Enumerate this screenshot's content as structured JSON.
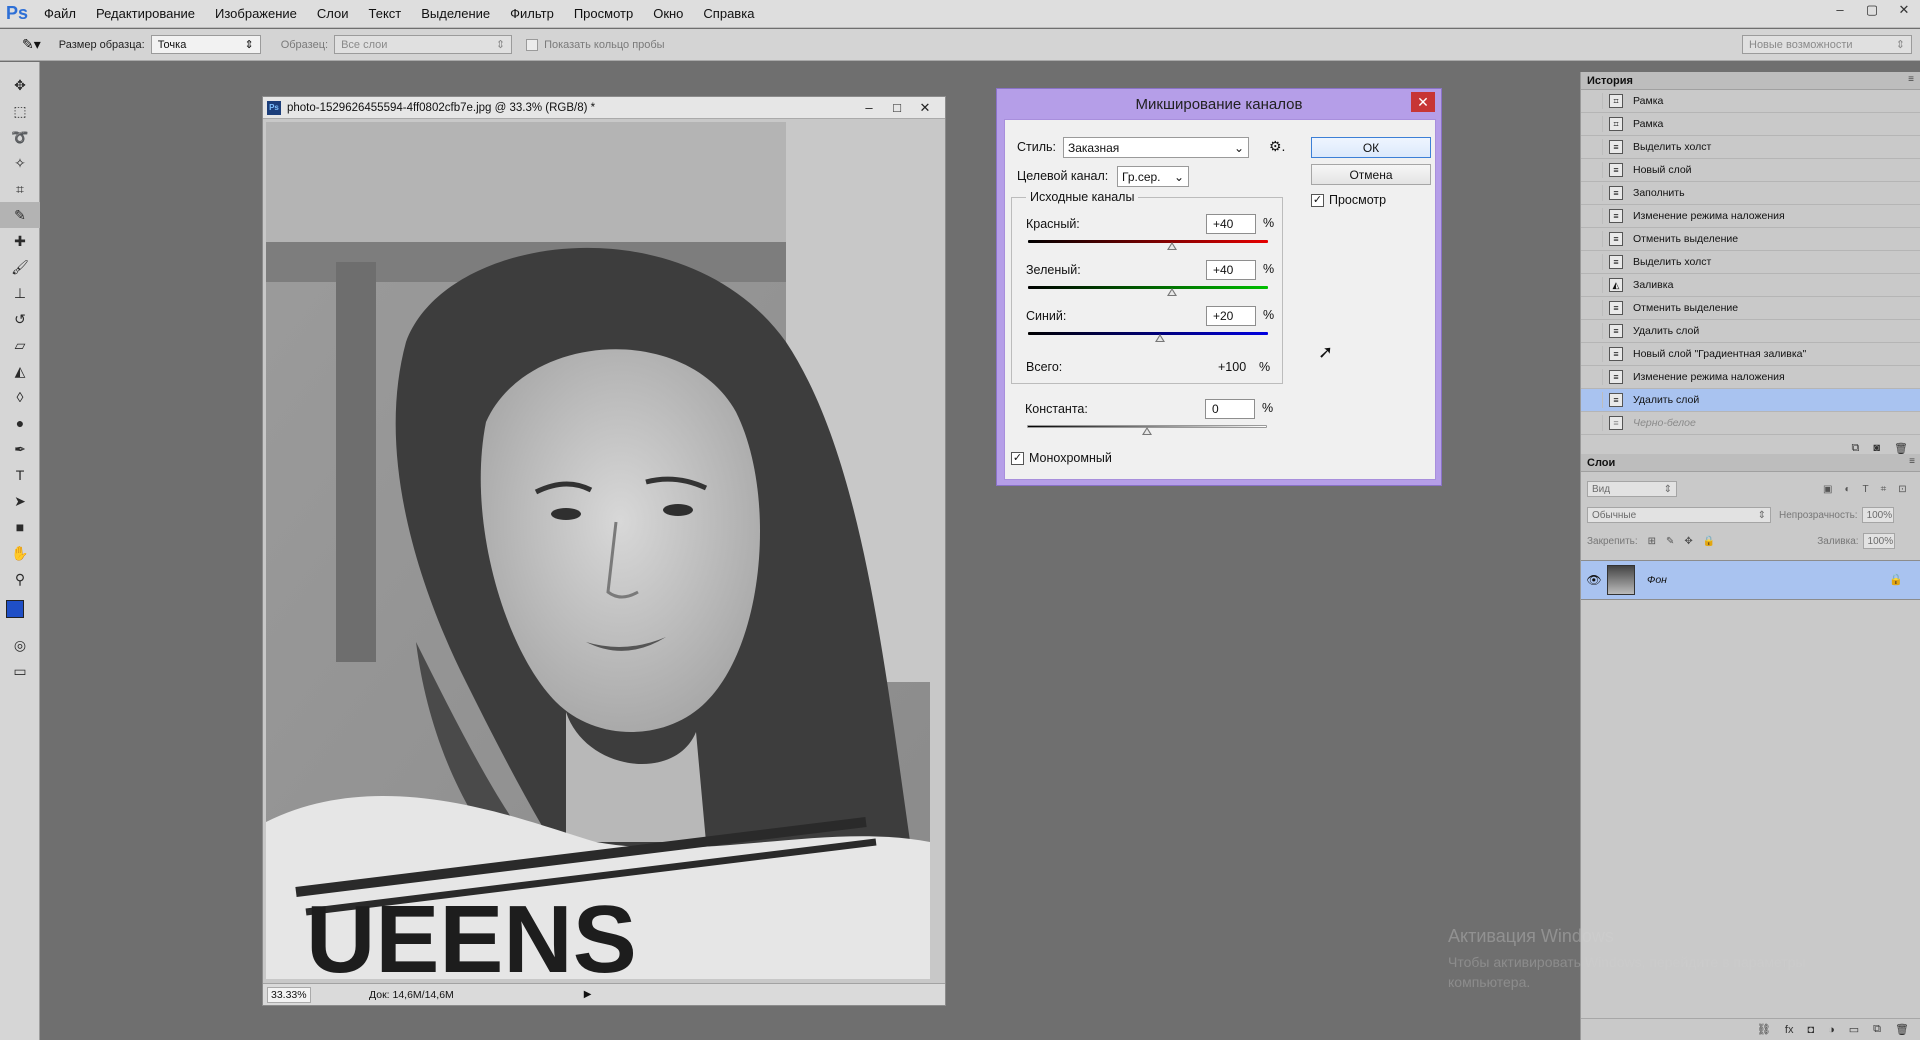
{
  "menubar": {
    "logo": "Ps",
    "items": [
      "Файл",
      "Редактирование",
      "Изображение",
      "Слои",
      "Текст",
      "Выделение",
      "Фильтр",
      "Просмотр",
      "Окно",
      "Справка"
    ],
    "window_controls": [
      "–",
      "▢",
      "✕"
    ]
  },
  "options_bar": {
    "sample_size_label": "Размер образца:",
    "sample_size_value": "Точка",
    "samples_label": "Образец:",
    "samples_value": "Все слои",
    "show_ring_label": "Показать кольцо пробы",
    "workspace_value": "Новые возможности"
  },
  "document": {
    "title": "photo-1529626455594-4ff0802cfb7e.jpg @ 33.3% (RGB/8) *",
    "zoom": "33.33%",
    "doc_info": "Док: 14,6M/14,6M",
    "shirt_text": "UEENS"
  },
  "dialog": {
    "title": "Микширование каналов",
    "style_label": "Стиль:",
    "style_value": "Заказная",
    "target_label": "Целевой канал:",
    "target_value": "Гр.сер.",
    "ok_label": "ОК",
    "cancel_label": "Отмена",
    "preview_label": "Просмотр",
    "preview_checked": true,
    "source_group_label": "Исходные каналы",
    "channels": [
      {
        "label": "Красный:",
        "value": "+40",
        "unit": "%",
        "position": 0.6,
        "gradient": "linear-gradient(90deg, #000, #e60000)"
      },
      {
        "label": "Зеленый:",
        "value": "+40",
        "unit": "%",
        "position": 0.6,
        "gradient": "linear-gradient(90deg, #000, #00c000)"
      },
      {
        "label": "Синий:",
        "value": "+20",
        "unit": "%",
        "position": 0.55,
        "gradient": "linear-gradient(90deg, #000, #0000e0)"
      }
    ],
    "total_label": "Всего:",
    "total_value": "+100",
    "total_unit": "%",
    "constant_label": "Константа:",
    "constant_value": "0",
    "constant_unit": "%",
    "constant_position": 0.5,
    "mono_label": "Монохромный",
    "mono_checked": true
  },
  "history": {
    "tab": "История",
    "items": [
      {
        "label": "Рамка",
        "icon": "crop-icon",
        "state": "normal"
      },
      {
        "label": "Рамка",
        "icon": "crop-icon",
        "state": "normal"
      },
      {
        "label": "Выделить холст",
        "icon": "doc-icon",
        "state": "normal"
      },
      {
        "label": "Новый слой",
        "icon": "doc-icon",
        "state": "normal"
      },
      {
        "label": "Заполнить",
        "icon": "doc-icon",
        "state": "normal"
      },
      {
        "label": "Изменение режима наложения",
        "icon": "doc-icon",
        "state": "normal"
      },
      {
        "label": "Отменить выделение",
        "icon": "doc-icon",
        "state": "normal"
      },
      {
        "label": "Выделить холст",
        "icon": "doc-icon",
        "state": "normal"
      },
      {
        "label": "Заливка",
        "icon": "bucket-icon",
        "state": "normal"
      },
      {
        "label": "Отменить выделение",
        "icon": "doc-icon",
        "state": "normal"
      },
      {
        "label": "Удалить слой",
        "icon": "doc-icon",
        "state": "normal"
      },
      {
        "label": "Новый слой \"Градиентная заливка\"",
        "icon": "doc-icon",
        "state": "normal"
      },
      {
        "label": "Изменение режима наложения",
        "icon": "doc-icon",
        "state": "normal"
      },
      {
        "label": "Удалить слой",
        "icon": "doc-icon",
        "state": "selected"
      },
      {
        "label": "Черно-белое",
        "icon": "doc-icon",
        "state": "disabled"
      }
    ]
  },
  "layers": {
    "tab": "Слои",
    "kind_value": "Вид",
    "blend_value": "Обычные",
    "opacity_label": "Непрозрачность:",
    "opacity_value": "100%",
    "lock_label": "Закрепить:",
    "fill_label": "Заливка:",
    "fill_value": "100%",
    "layer_name": "Фон"
  },
  "watermark": {
    "line1": "Активация Windows",
    "line2": "Чтобы активировать Windows, перейдите в параметры компьютера."
  },
  "colors": {
    "dialog_frame": "#b59ee8",
    "selection": "#a9c3f0",
    "foreground": "#1f4fc6"
  }
}
